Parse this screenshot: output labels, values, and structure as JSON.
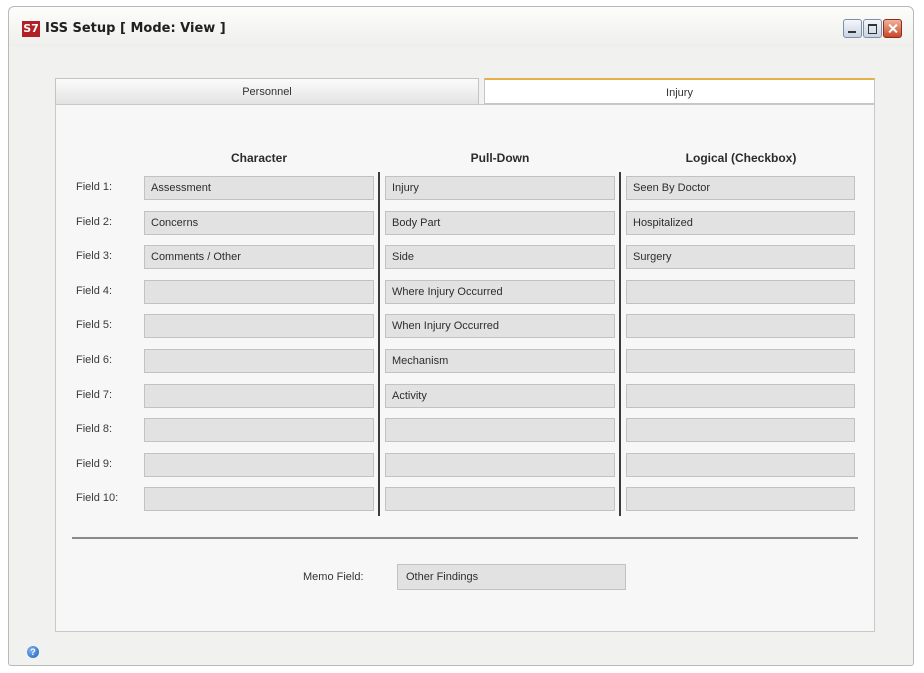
{
  "window": {
    "title": "ISS Setup  [ Mode: View ]",
    "app_icon_text": "S7"
  },
  "tabs": [
    {
      "label": "Personnel"
    },
    {
      "label": "Injury"
    }
  ],
  "columns": {
    "character": "Character",
    "pulldown": "Pull-Down",
    "logical": "Logical (Checkbox)"
  },
  "rows": [
    {
      "label": "Field 1:",
      "character": "Assessment",
      "pulldown": "Injury",
      "logical": "Seen By Doctor"
    },
    {
      "label": "Field 2:",
      "character": "Concerns",
      "pulldown": "Body Part",
      "logical": "Hospitalized"
    },
    {
      "label": "Field 3:",
      "character": "Comments / Other",
      "pulldown": "Side",
      "logical": "Surgery"
    },
    {
      "label": "Field 4:",
      "character": "",
      "pulldown": "Where Injury Occurred",
      "logical": ""
    },
    {
      "label": "Field 5:",
      "character": "",
      "pulldown": "When Injury Occurred",
      "logical": ""
    },
    {
      "label": "Field 6:",
      "character": "",
      "pulldown": "Mechanism",
      "logical": ""
    },
    {
      "label": "Field 7:",
      "character": "",
      "pulldown": "Activity",
      "logical": ""
    },
    {
      "label": "Field 8:",
      "character": "",
      "pulldown": "",
      "logical": ""
    },
    {
      "label": "Field 9:",
      "character": "",
      "pulldown": "",
      "logical": ""
    },
    {
      "label": "Field 10:",
      "character": "",
      "pulldown": "",
      "logical": ""
    }
  ],
  "memo": {
    "label": "Memo Field:",
    "value": "Other Findings"
  },
  "help": {
    "glyph": "?"
  },
  "colors": {
    "active_tab_accent": "#e4b04a",
    "field_bg": "#e2e2e2",
    "close_button": "#c7462a"
  }
}
